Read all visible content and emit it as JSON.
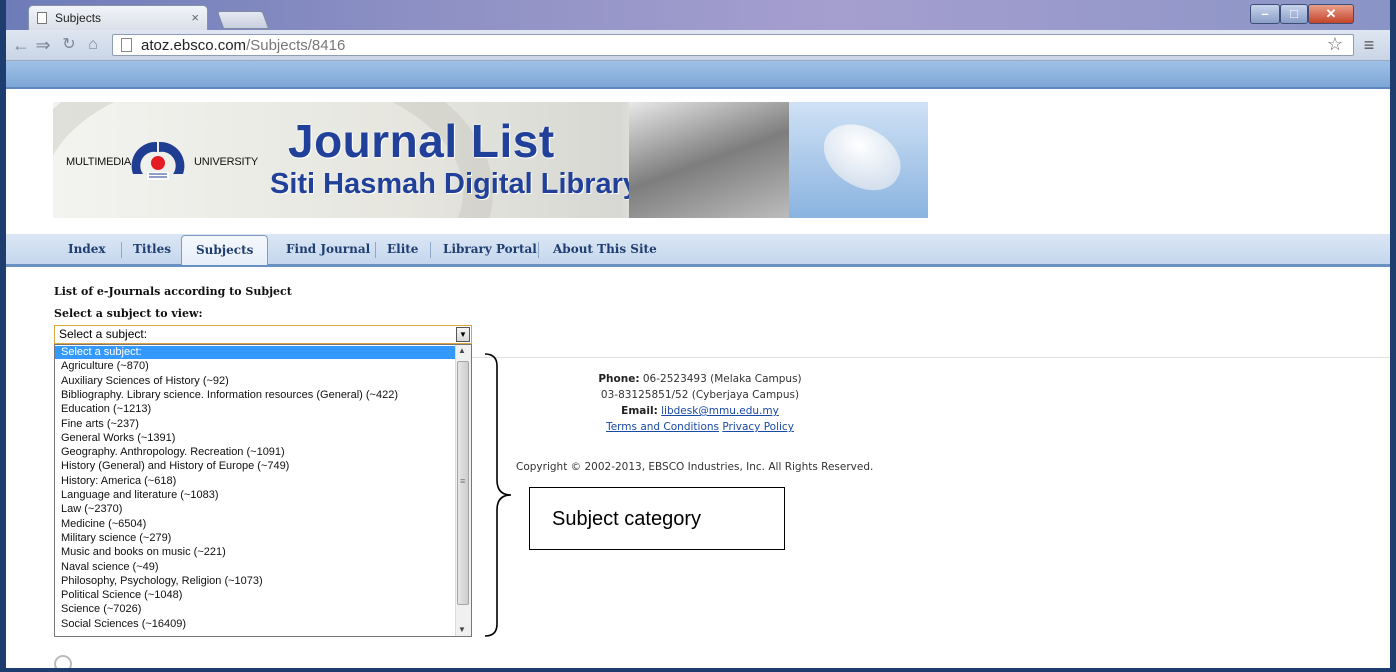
{
  "browser": {
    "tab_title": "Subjects",
    "tab_close": "×",
    "url_host": "atoz.ebsco.com",
    "url_path": "/Subjects/8416"
  },
  "window_controls": {
    "minimize": "–",
    "maximize": "□",
    "close": "✕"
  },
  "banner": {
    "logo_left": "MULTIMEDIA",
    "logo_right": "UNIVERSITY",
    "title": "Journal List",
    "subtitle": "Siti Hasmah Digital Library"
  },
  "nav": {
    "tabs": [
      "Index",
      "Titles",
      "Subjects",
      "Find Journal",
      "Elite",
      "Library Portal",
      "About This Site"
    ],
    "active": "Subjects"
  },
  "content": {
    "heading": "List of e-Journals according to Subject",
    "select_label": "Select a subject to view:",
    "select_value": "Select a subject:",
    "options": [
      "Select a subject:",
      "Agriculture (~870)",
      "Auxiliary Sciences of History (~92)",
      "Bibliography. Library science. Information resources (General) (~422)",
      "Education (~1213)",
      "Fine arts (~237)",
      "General Works (~1391)",
      "Geography. Anthropology. Recreation (~1091)",
      "History (General) and History of Europe (~749)",
      "History: America (~618)",
      "Language and literature (~1083)",
      "Law (~2370)",
      "Medicine (~6504)",
      "Military science (~279)",
      "Music and books on music (~221)",
      "Naval science (~49)",
      "Philosophy, Psychology, Religion (~1073)",
      "Political Science (~1048)",
      "Science (~7026)",
      "Social Sciences (~16409)"
    ],
    "selected_index": 0
  },
  "footer": {
    "phone_label": "Phone:",
    "phone_1": "06-2523493 (Melaka Campus)",
    "phone_2": "03-83125851/52 (Cyberjaya Campus)",
    "email_label": "Email:",
    "email": "libdesk@mmu.edu.my",
    "terms": "Terms and Conditions",
    "privacy": "Privacy Policy",
    "copyright": "Copyright © 2002-2013, EBSCO Industries, Inc. All Rights Reserved."
  },
  "annotation": {
    "label": "Subject category"
  },
  "colors": {
    "brand_blue": "#21409a",
    "nav_bg": "#c5d7ee",
    "selected_option": "#3399ff"
  }
}
